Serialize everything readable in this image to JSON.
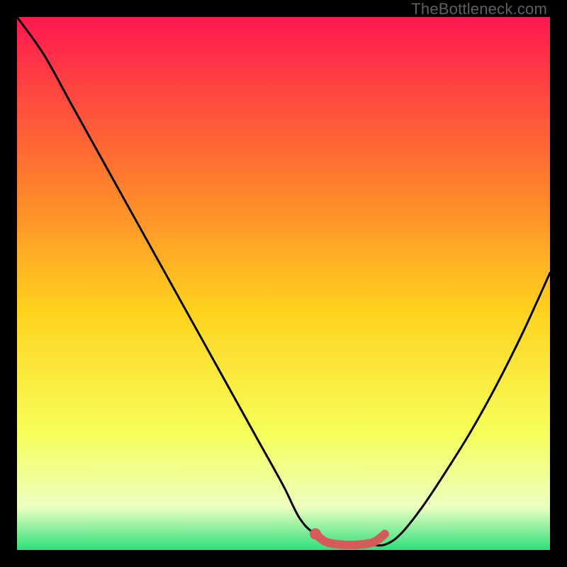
{
  "watermark": "TheBottleneck.com",
  "colors": {
    "frame": "#000000",
    "curve": "#000000",
    "highlight": "#d65a5a",
    "grad_top": "#ff1850",
    "grad_upper_mid": "#ff7a2e",
    "grad_mid": "#ffd21e",
    "grad_lower": "#f6ff5a",
    "grad_pale": "#ecffc0",
    "grad_green": "#2de07a"
  },
  "chart_data": {
    "type": "line",
    "title": "",
    "xlabel": "",
    "ylabel": "",
    "xlim": [
      0,
      100
    ],
    "ylim": [
      0,
      100
    ],
    "grid": false,
    "legend": false,
    "series": [
      {
        "name": "bottleneck-curve",
        "x": [
          0,
          5,
          10,
          15,
          20,
          25,
          30,
          35,
          40,
          45,
          50,
          53,
          56,
          61,
          66,
          69,
          72,
          76,
          80,
          85,
          90,
          95,
          100
        ],
        "y": [
          100,
          93,
          84,
          75,
          66,
          57,
          48,
          39,
          30,
          21,
          12,
          6,
          3,
          1,
          1,
          1,
          3,
          8,
          14,
          22,
          31,
          41,
          52
        ]
      },
      {
        "name": "optimal-band",
        "x": [
          56,
          58,
          61,
          64,
          67,
          69
        ],
        "y": [
          3,
          1.5,
          1,
          1,
          1.5,
          3
        ]
      }
    ],
    "highlight_point": {
      "x": 56,
      "y": 3
    },
    "annotations": []
  }
}
